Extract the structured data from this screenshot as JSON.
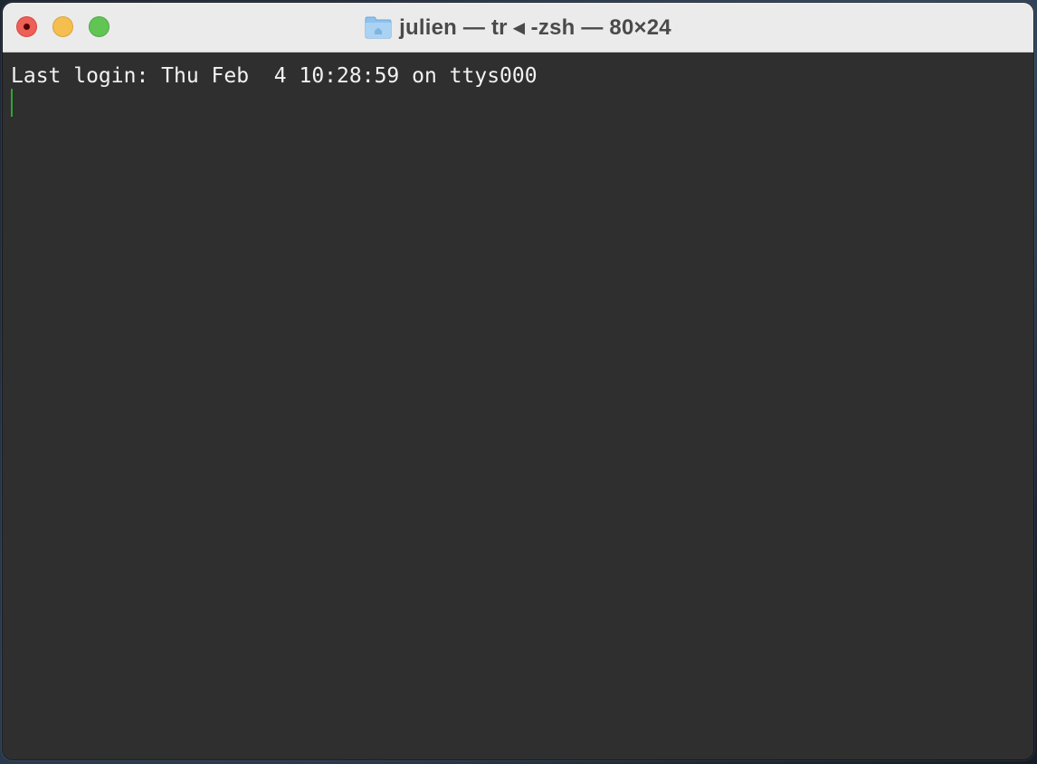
{
  "window": {
    "title": "julien — tr ◂ -zsh — 80×24",
    "title_icon": "home-folder-icon"
  },
  "traffic_lights": {
    "close_color": "#ee5f57",
    "minimize_color": "#f5bf4f",
    "zoom_color": "#61c554"
  },
  "terminal": {
    "lines": [
      "Last login: Thu Feb  4 10:28:59 on ttys000"
    ],
    "cursor_color": "#2fa52f",
    "background_color": "#2f2f2f",
    "text_color": "#f2f2f2"
  }
}
